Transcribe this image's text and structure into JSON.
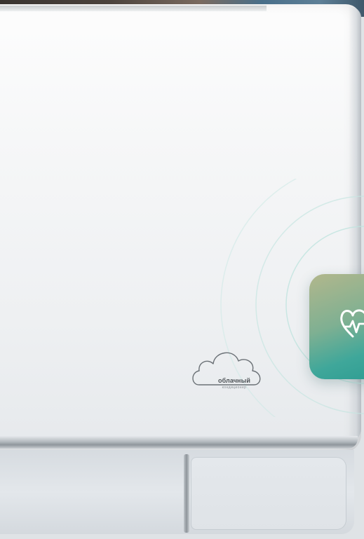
{
  "product": {
    "cloud_label": "облачный",
    "cloud_sublabel": "кондиционер"
  },
  "icons": {
    "cloud": "cloud-outline-icon",
    "health": "heart-pulse-icon"
  },
  "colors": {
    "body": "#f3f5f6",
    "badge_top": "#b2b78c",
    "badge_bottom": "#2d9c92",
    "ring": "#bfe3de"
  }
}
